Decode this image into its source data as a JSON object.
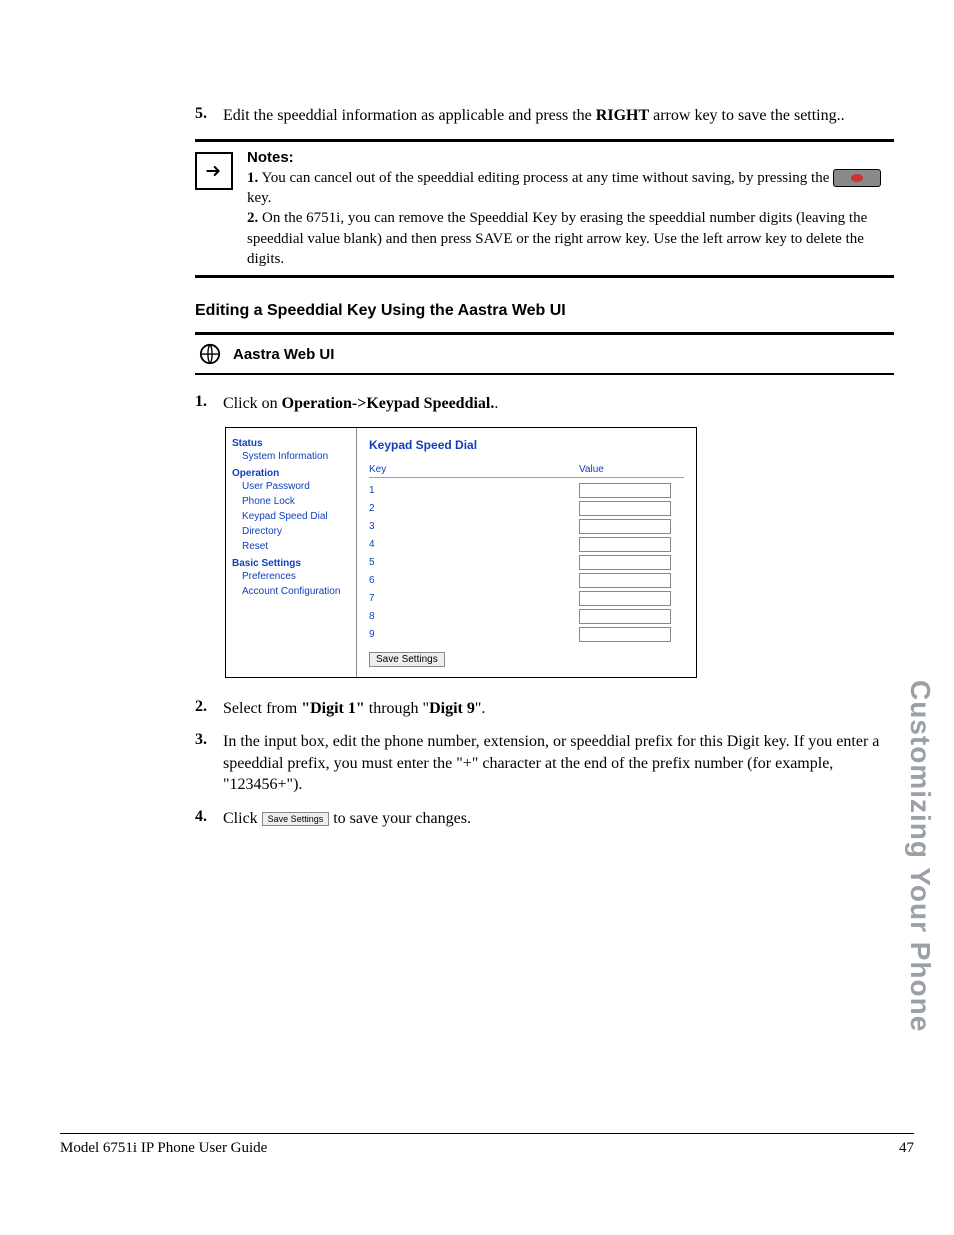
{
  "step5": {
    "number": "5.",
    "text_pre": "Edit the speeddial information as applicable and press the ",
    "bold1": "RIGHT",
    "text_post": " arrow key to save the setting.."
  },
  "notes": {
    "heading": "Notes:",
    "n1_num": "1.",
    "n1_text_a": "   You can cancel out of the speeddial editing process at any time without saving, by pressing the ",
    "n1_text_b": " key.",
    "n2_num": "2.",
    "n2_text": "   On the 6751i, you can remove the Speeddial Key by erasing the speeddial number digits (leaving the speeddial value blank) and then press SAVE or the right arrow key. Use the left arrow key to delete the digits."
  },
  "section_heading": "Editing a Speeddial Key Using the Aastra Web UI",
  "web_ui_bar_label": "Aastra Web UI",
  "step1": {
    "number": "1.",
    "text_pre": "Click on ",
    "bold": "Operation->Keypad Speeddial.",
    "text_post": "."
  },
  "screenshot": {
    "sidebar": {
      "status_head": "Status",
      "status_item": "System Information",
      "operation_head": "Operation",
      "op_items": [
        "User Password",
        "Phone Lock",
        "Keypad Speed Dial",
        "Directory",
        "Reset"
      ],
      "basic_head": "Basic Settings",
      "basic_items": [
        "Preferences",
        "Account Configuration"
      ]
    },
    "main": {
      "title": "Keypad Speed Dial",
      "col_key": "Key",
      "col_val": "Value",
      "keys": [
        "1",
        "2",
        "3",
        "4",
        "5",
        "6",
        "7",
        "8",
        "9"
      ],
      "save_label": "Save Settings"
    }
  },
  "step2": {
    "number": "2.",
    "text_a": "Select from ",
    "bold1": "\"Digit 1\"",
    "text_b": " through \"",
    "bold2": "Digit 9",
    "text_c": "\"."
  },
  "step3": {
    "number": "3.",
    "text": "In the input box, edit the phone number, extension, or speeddial prefix for this Digit key. If you enter a speeddial prefix, you must enter the \"+\" character at the end of the prefix number (for example, \"123456+\")."
  },
  "step4": {
    "number": "4.",
    "text_a": "Click ",
    "btn": "Save Settings",
    "text_b": " to save your changes."
  },
  "side_tab": "Customizing Your Phone",
  "footer": {
    "left": "Model 6751i IP Phone User Guide",
    "right": "47"
  }
}
